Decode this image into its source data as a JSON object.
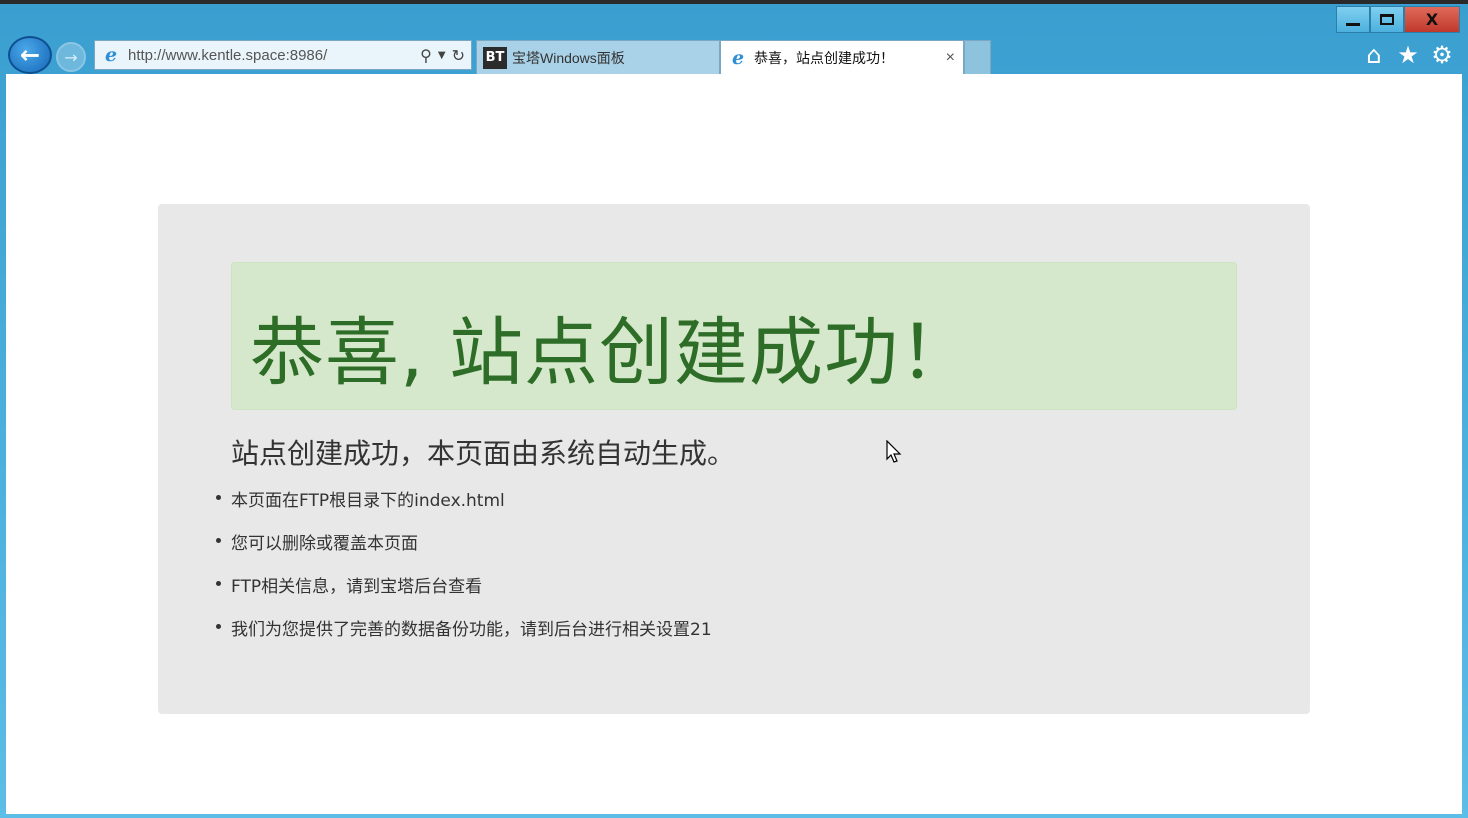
{
  "browser": {
    "address": "http://www.kentle.space:8986/",
    "tabs": [
      {
        "logo": "BT",
        "label": "宝塔Windows面板"
      },
      {
        "label": "恭喜，站点创建成功！",
        "close": "×"
      }
    ],
    "window_controls": {
      "close": "X"
    },
    "icons": [
      "back-arrow-icon",
      "forward-arrow-icon",
      "ie-icon",
      "search-icon",
      "dropdown-icon",
      "refresh-icon",
      "home-icon",
      "star-icon",
      "gear-icon"
    ]
  },
  "page": {
    "headline": "恭喜, 站点创建成功！",
    "subtitle": "站点创建成功，本页面由系统自动生成。",
    "items": [
      "本页面在FTP根目录下的index.html",
      "您可以删除或覆盖本页面",
      "FTP相关信息，请到宝塔后台查看",
      "我们为您提供了完善的数据备份功能，请到后台进行相关设置21"
    ]
  },
  "colors": {
    "headline": "#2e6d27",
    "alert_bg": "#d6e8cc",
    "jumbotron_bg": "#e8e8e8",
    "chrome": "#5cbde6"
  }
}
